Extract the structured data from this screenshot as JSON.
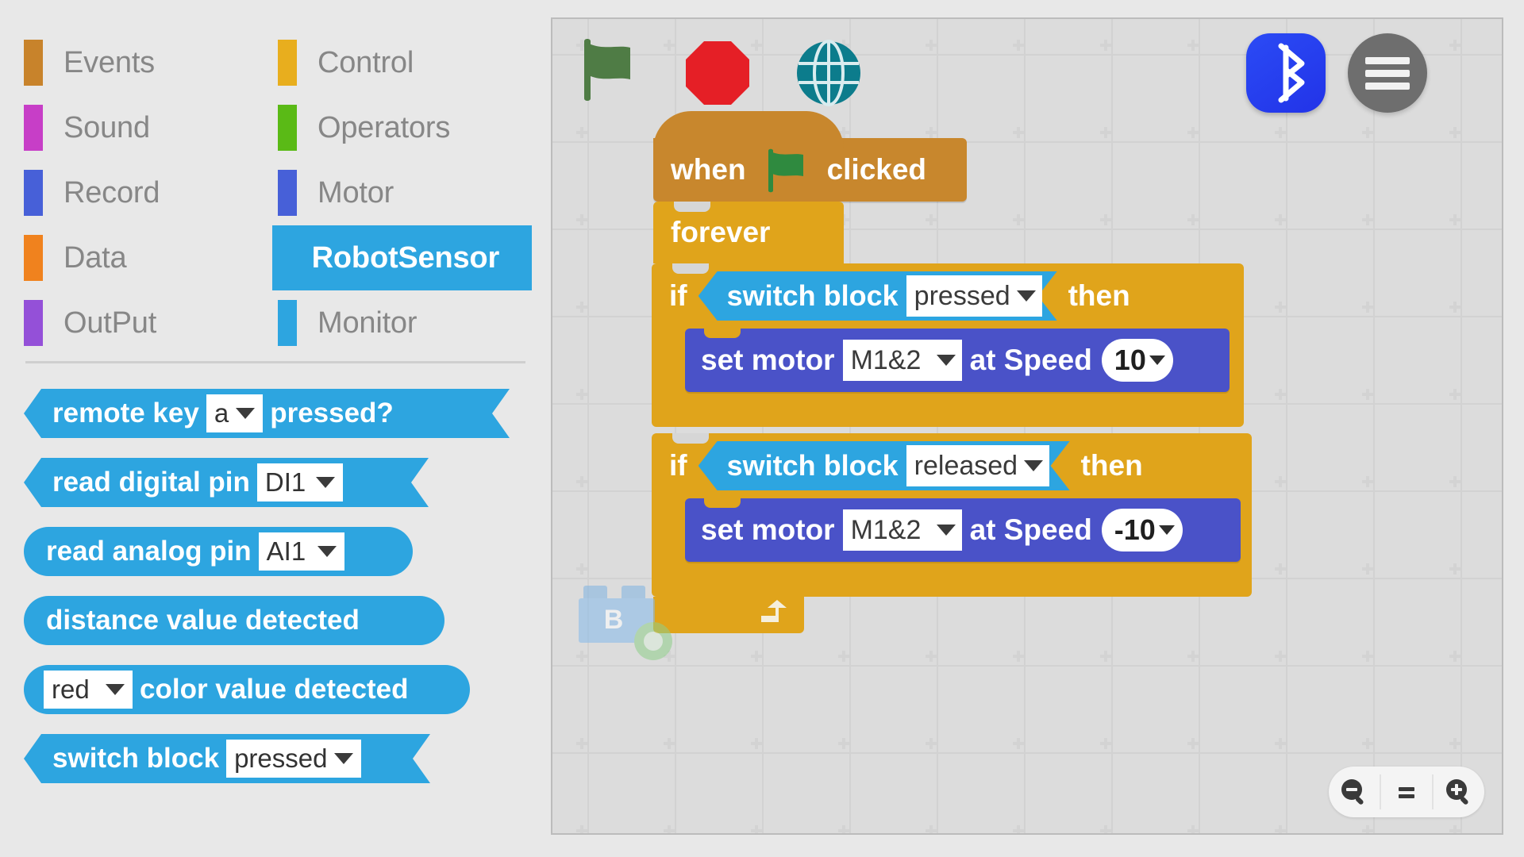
{
  "categories": [
    {
      "label": "Events",
      "color": "#c8832b",
      "active": false
    },
    {
      "label": "Control",
      "color": "#e8ae1e",
      "active": false
    },
    {
      "label": "Sound",
      "color": "#c73ec7",
      "active": false
    },
    {
      "label": "Operators",
      "color": "#5aba16",
      "active": false
    },
    {
      "label": "Record",
      "color": "#4760d8",
      "active": false
    },
    {
      "label": "Motor",
      "color": "#4760d8",
      "active": false
    },
    {
      "label": "Data",
      "color": "#f0821e",
      "active": false
    },
    {
      "label": "RobotSensor",
      "color": "#2da5e0",
      "active": true
    },
    {
      "label": "OutPut",
      "color": "#9450d8",
      "active": false
    },
    {
      "label": "Monitor",
      "color": "#2da5e0",
      "active": false
    }
  ],
  "palette": {
    "blocks": [
      {
        "shape": "hexagon",
        "parts": [
          {
            "t": "text",
            "v": "remote key"
          },
          {
            "t": "field",
            "v": "a"
          },
          {
            "t": "text",
            "v": "pressed?"
          }
        ]
      },
      {
        "shape": "hexagon",
        "parts": [
          {
            "t": "text",
            "v": "read  digital pin"
          },
          {
            "t": "field",
            "v": "DI1"
          }
        ]
      },
      {
        "shape": "oval",
        "parts": [
          {
            "t": "text",
            "v": "read  analog pin"
          },
          {
            "t": "field",
            "v": "AI1"
          }
        ]
      },
      {
        "shape": "oval",
        "parts": [
          {
            "t": "text",
            "v": "distance value detected"
          }
        ]
      },
      {
        "shape": "oval",
        "parts": [
          {
            "t": "field",
            "v": "red"
          },
          {
            "t": "text",
            "v": "color value detected"
          }
        ]
      },
      {
        "shape": "hexagon",
        "parts": [
          {
            "t": "text",
            "v": "switch block"
          },
          {
            "t": "field",
            "v": "pressed"
          }
        ]
      }
    ]
  },
  "toolbar": {
    "green_flag": "green-flag-icon",
    "stop": "stop-sign-icon",
    "globe": "globe-icon",
    "bluetooth": "bluetooth-icon",
    "menu": "hamburger-menu-icon"
  },
  "script": {
    "hat": {
      "pre": "when",
      "post": "clicked"
    },
    "forever": {
      "label": "forever"
    },
    "branches": [
      {
        "if_label": "if",
        "then_label": "then",
        "condition": {
          "label": "switch block",
          "value": "pressed"
        },
        "action": {
          "pre": "set motor",
          "port": "M1&2",
          "mid": "at Speed",
          "speed": "10"
        }
      },
      {
        "if_label": "if",
        "then_label": "then",
        "condition": {
          "label": "switch block",
          "value": "released"
        },
        "action": {
          "pre": "set motor",
          "port": "M1&2",
          "mid": "at Speed",
          "speed": "-10"
        }
      }
    ]
  },
  "sprite": {
    "letter": "B"
  },
  "zoom_controls": {
    "zoom_out": "zoom-out-icon",
    "zoom_reset": "zoom-reset-icon",
    "zoom_in": "zoom-in-icon"
  },
  "colors": {
    "accent_blue": "#2da5e0",
    "control_yellow": "#e0a41b",
    "events_brown": "#c8872d",
    "motor_purple": "#4a52c8",
    "stop_red": "#e51f26",
    "flag_green": "#4f7c45",
    "globe_teal": "#0c7c8c",
    "bluetooth_blue": "#2b3cf0"
  }
}
